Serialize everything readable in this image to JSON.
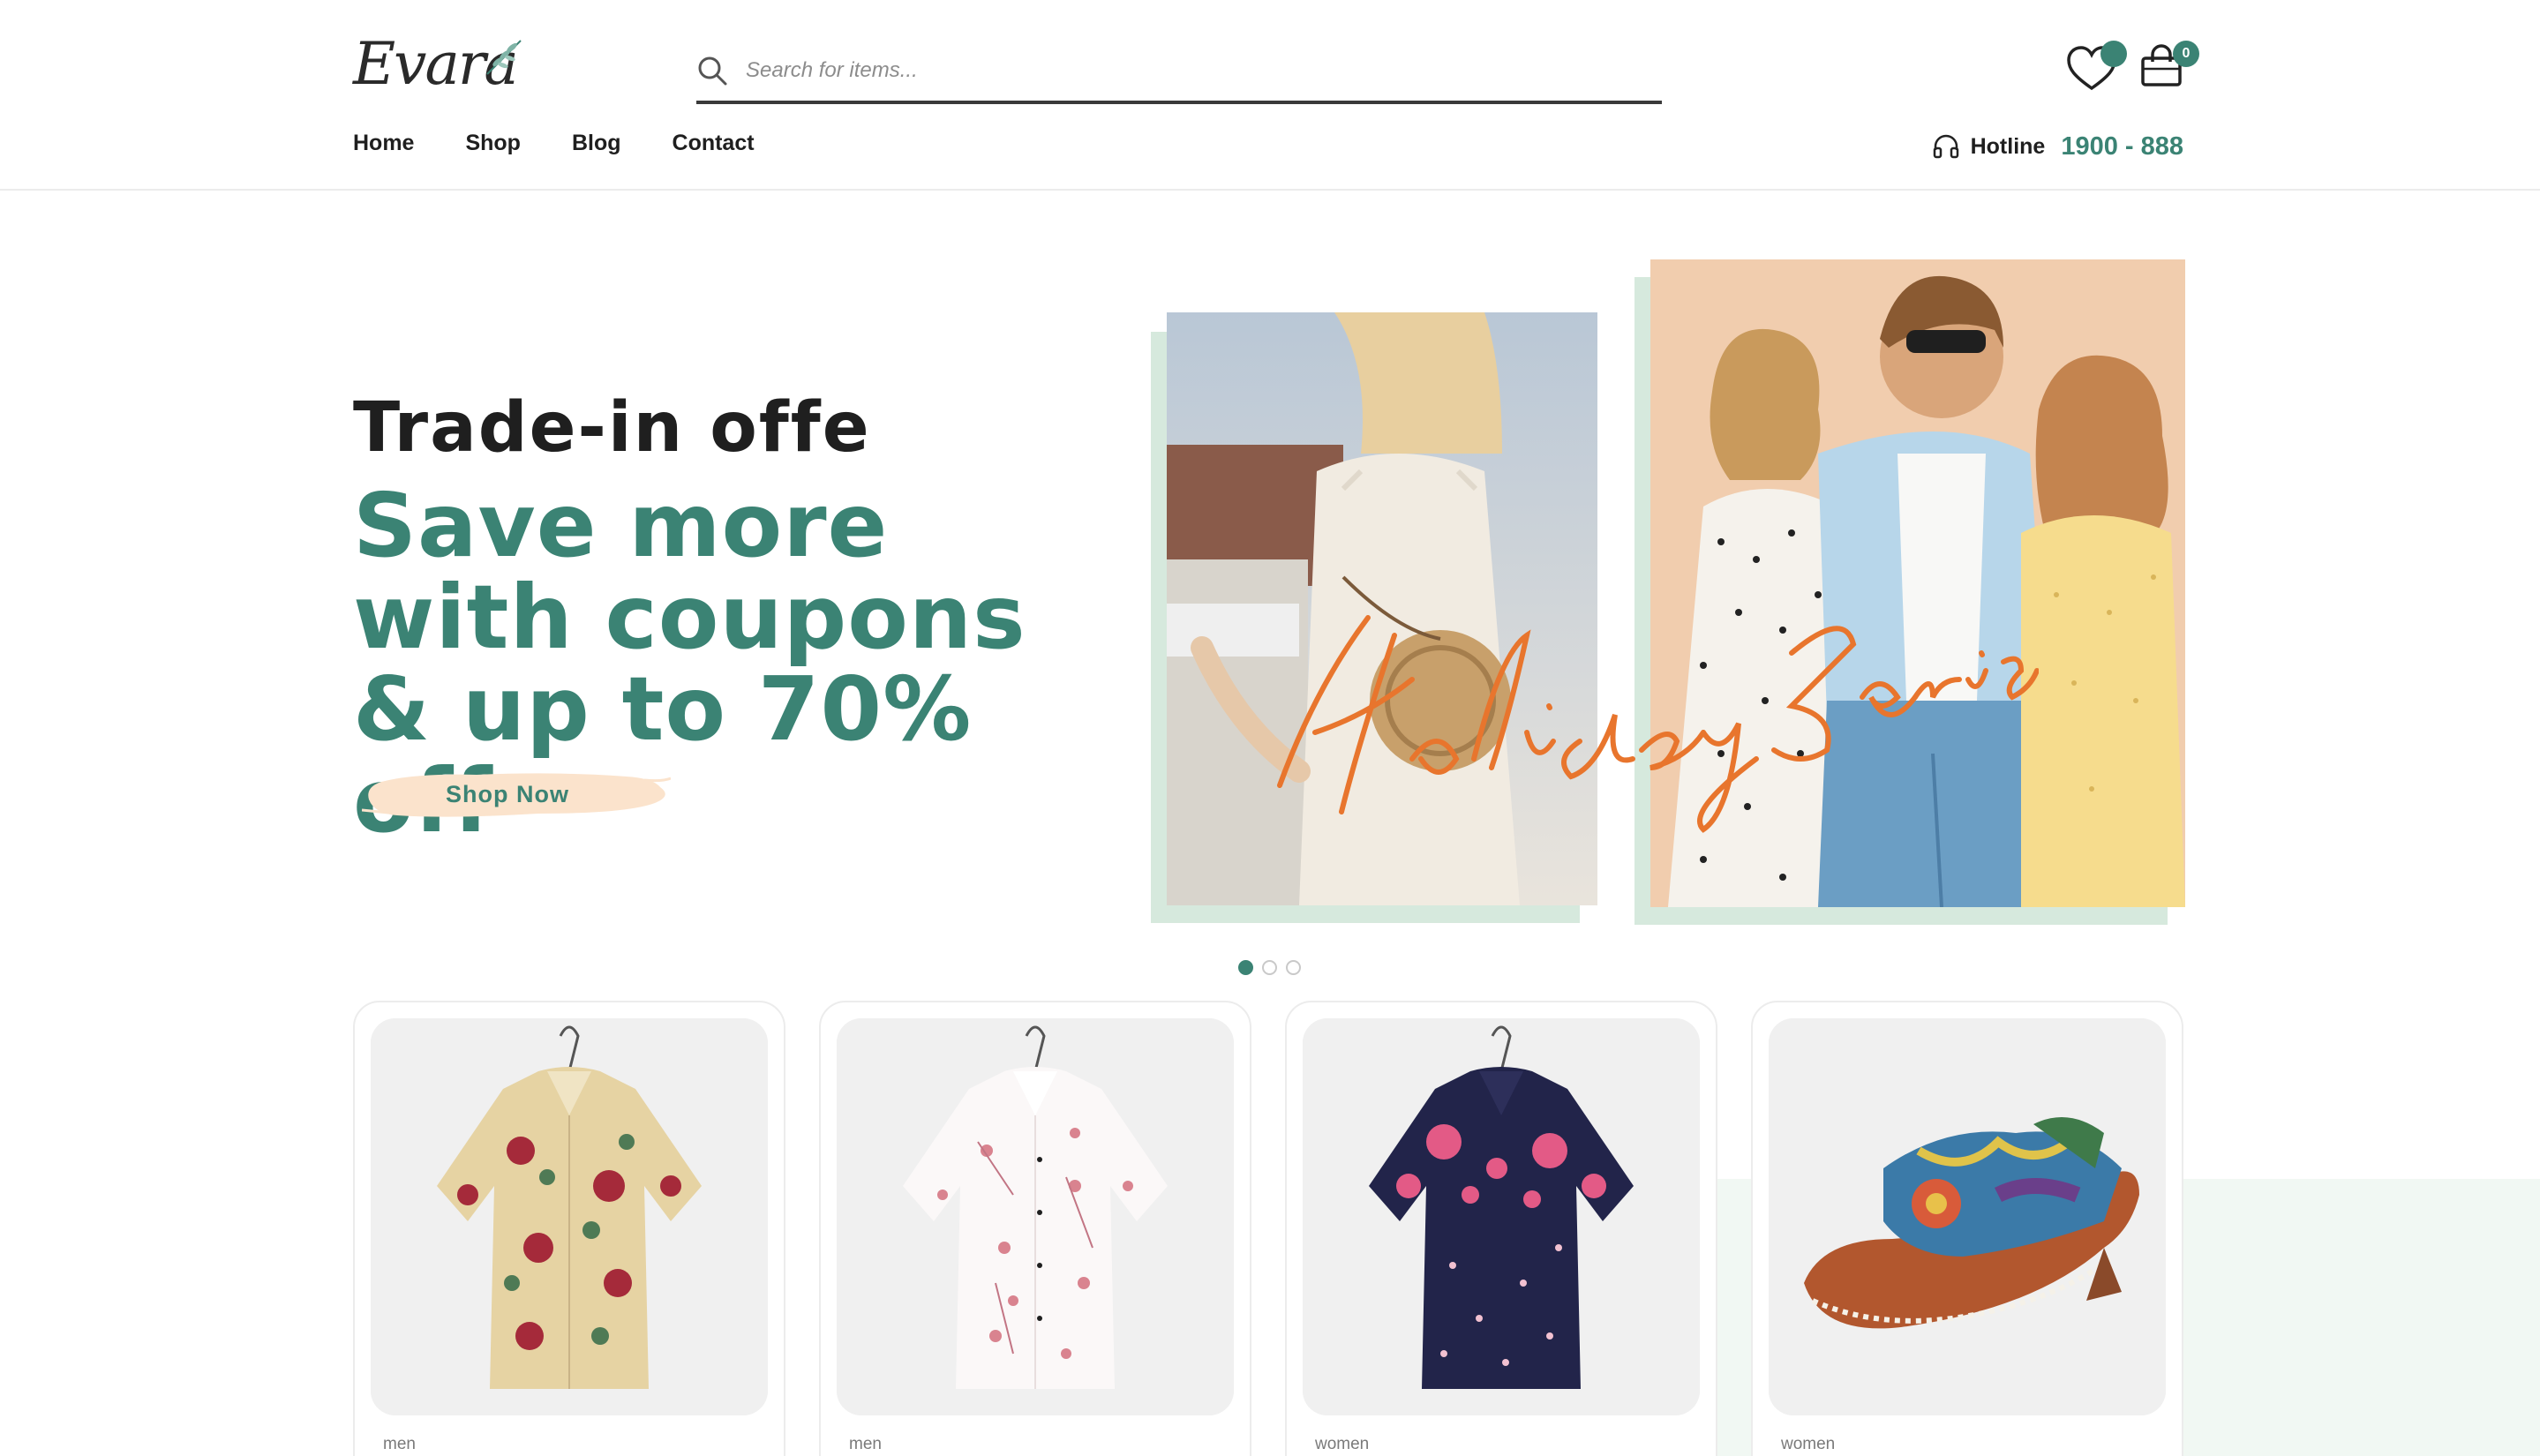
{
  "header": {
    "logo_text": "Evara",
    "search": {
      "placeholder": "Search for items..."
    },
    "cart_count": "0",
    "nav": [
      {
        "label": "Home"
      },
      {
        "label": "Shop"
      },
      {
        "label": "Blog"
      },
      {
        "label": "Contact"
      }
    ],
    "hotline": {
      "label": "Hotline",
      "number": "1900 - 888"
    }
  },
  "hero": {
    "subtitle": "Trade-in offe",
    "headline": "Save more with coupons & up to 70% off",
    "button_label": "Shop Now",
    "image_script_text": "Holiday Series",
    "slider": {
      "count": 3,
      "active": 0
    }
  },
  "products": [
    {
      "category": "men",
      "image": "floral-beige-shirt"
    },
    {
      "category": "men",
      "image": "white-cherry-blossom-shirt"
    },
    {
      "category": "women",
      "image": "navy-floral-shirt"
    },
    {
      "category": "women",
      "image": "patterned-leather-sandal"
    }
  ],
  "colors": {
    "accent": "#3b8374",
    "accent_light": "#d6e9dd",
    "button_bg": "#fbe3cc",
    "text_dark": "#1f1f1f",
    "script_orange": "#e8752d"
  }
}
